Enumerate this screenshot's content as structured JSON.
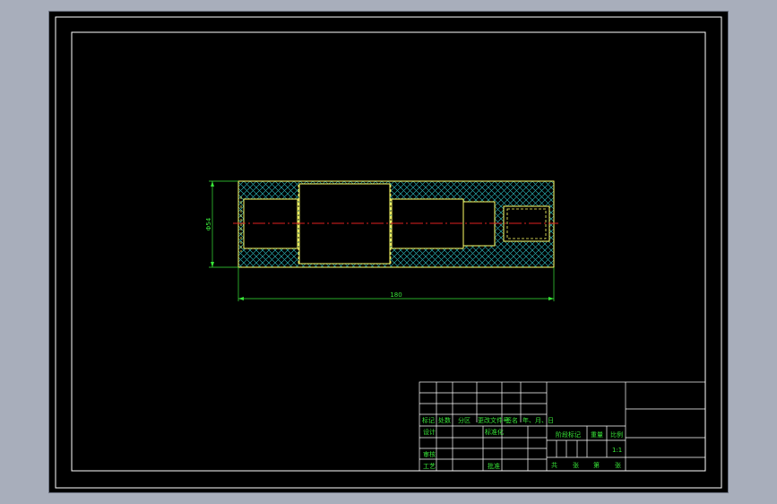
{
  "colors": {
    "background": "#000000",
    "frame": "#ffffff",
    "outline": "#ffff66",
    "hatch": "#2ec4c8",
    "centerline": "#e02020",
    "dimension": "#38e638",
    "titleblock_text": "#38e638"
  },
  "drawing": {
    "dim_height": "Φ54",
    "dim_length": "180"
  },
  "titleblock": {
    "row1": {
      "c1": "标记",
      "c2": "处数",
      "c3": "分区",
      "c4": "更改文件号",
      "c5": "签名",
      "c6": "年、月、日"
    },
    "row2": {
      "c1": "设计",
      "c2": "标准化"
    },
    "row3": {
      "c1": "审核"
    },
    "row4": {
      "c1": "工艺",
      "c2": "批准"
    },
    "stage_label": "阶段标记",
    "weight_label": "重量",
    "scale_label": "比例",
    "scale_value": "1:1",
    "sheets": {
      "total": "共",
      "total_unit": "张",
      "page": "第",
      "page_unit": "张"
    }
  }
}
